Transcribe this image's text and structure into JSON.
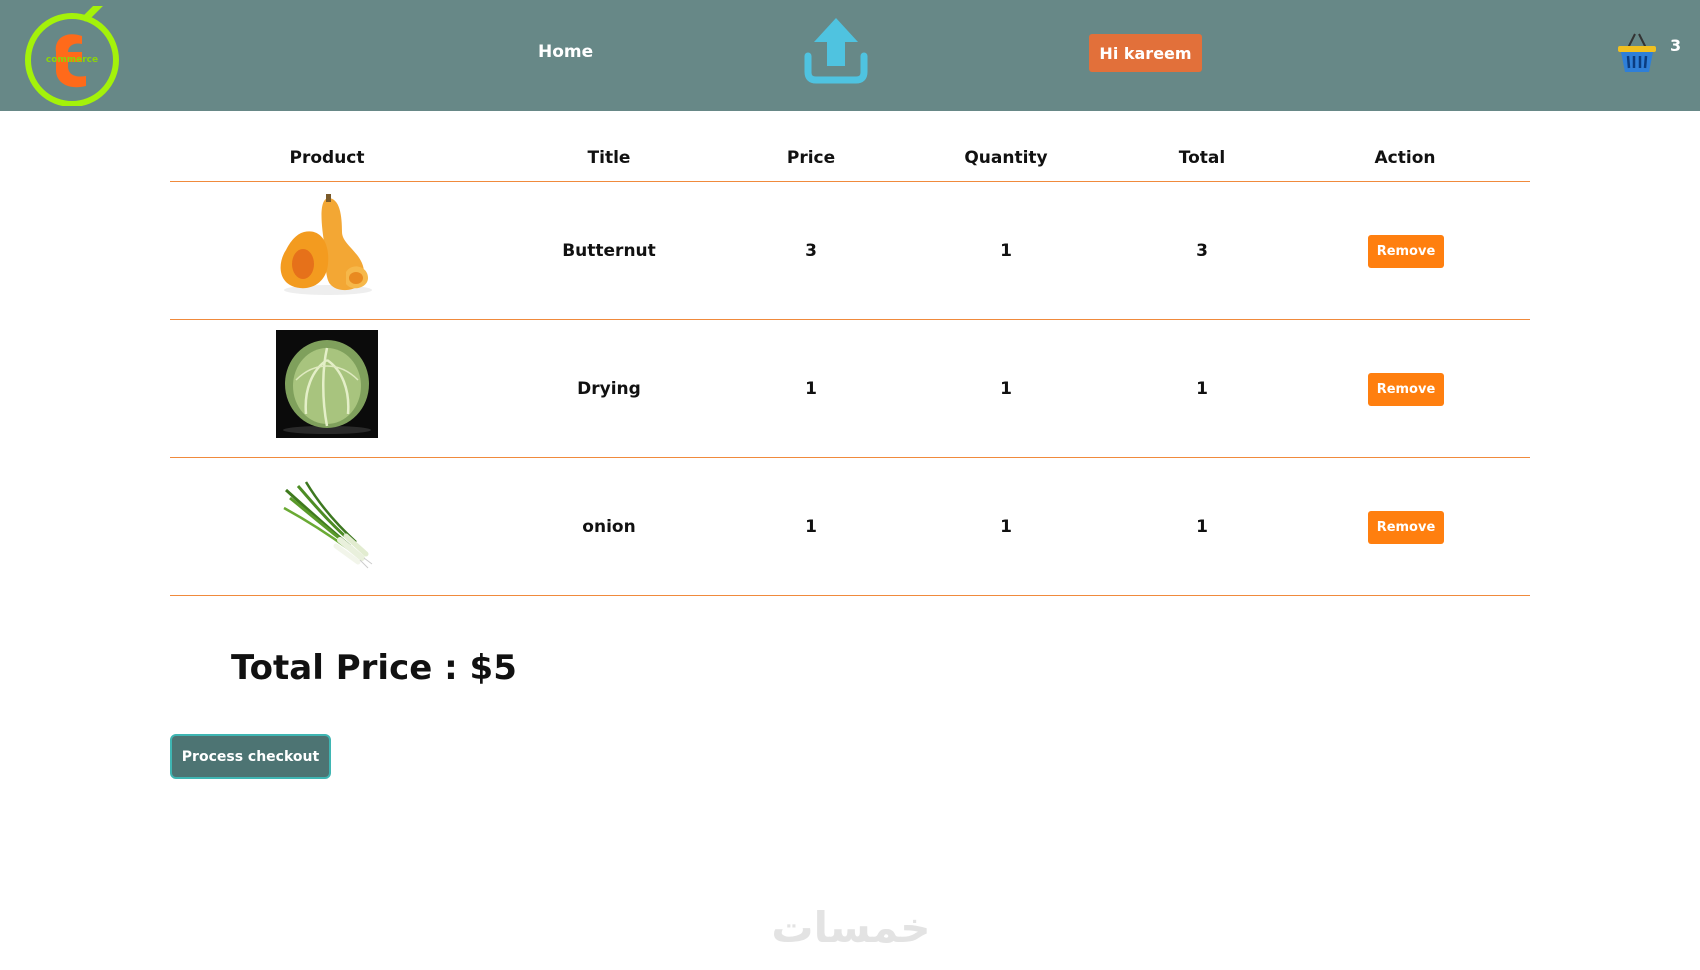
{
  "header": {
    "logo_text": "commerce",
    "home_label": "Home",
    "greeting": "Hi kareem",
    "cart_count": "3"
  },
  "cart_table": {
    "columns": [
      "Product",
      "Title",
      "Price",
      "Quantity",
      "Total",
      "Action"
    ],
    "rows": [
      {
        "title": "Butternut",
        "price": "3",
        "quantity": "1",
        "total": "3",
        "action": "Remove",
        "image": "butternut-squash"
      },
      {
        "title": "Drying",
        "price": "1",
        "quantity": "1",
        "total": "1",
        "action": "Remove",
        "image": "cabbage"
      },
      {
        "title": "onion",
        "price": "1",
        "quantity": "1",
        "total": "1",
        "action": "Remove",
        "image": "green-onion"
      }
    ]
  },
  "summary": {
    "total_price": "Total Price : $5",
    "checkout_label": "Process checkout"
  },
  "watermark": "خمسات",
  "colors": {
    "navbar": "#678887",
    "accent_orange": "#ff7f0f",
    "greeting_bg": "#e2703a",
    "checkout_bg": "#4d7473",
    "logo_ring": "#a4f20a"
  }
}
